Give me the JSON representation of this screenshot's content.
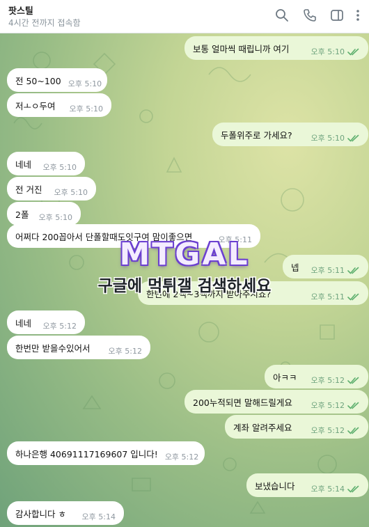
{
  "header": {
    "title": "팟스틸",
    "status": "4시간 전까지 접속함",
    "icons": [
      "search-icon",
      "phone-icon",
      "sidebar-toggle-icon",
      "more-vertical-icon"
    ]
  },
  "messages": [
    {
      "dir": "out",
      "text": "보통 얼마씩 때립니까 여기",
      "time": "오후 5:10"
    },
    {
      "dir": "in",
      "text": "전 50~100",
      "time": "오후 5:10"
    },
    {
      "dir": "in",
      "text": "저ㅗㅇ두여",
      "time": "오후 5:10"
    },
    {
      "dir": "out",
      "text": "두폴위주로 가세요?",
      "time": "오후 5:10"
    },
    {
      "dir": "in",
      "text": "네네",
      "time": "오후 5:10"
    },
    {
      "dir": "in",
      "text": "전 거진",
      "time": "오후 5:10"
    },
    {
      "dir": "in",
      "text": "2폴",
      "time": "오후 5:10"
    },
    {
      "dir": "in",
      "text": "어쩌다 200꼽아서 단폴할때도잇구여 맘이좋으면",
      "time": "오후 5:11"
    },
    {
      "dir": "out",
      "text": "넵",
      "time": "오후 5:11"
    },
    {
      "dir": "out",
      "text": "한번에 2백~3백까지 받아주시죠?",
      "time": "오후 5:11"
    },
    {
      "dir": "in",
      "text": "네네",
      "time": "오후 5:12"
    },
    {
      "dir": "in",
      "text": "한번만 받을수있어서",
      "time": "오후 5:12"
    },
    {
      "dir": "out",
      "text": "아ㅋㅋ",
      "time": "오후 5:12"
    },
    {
      "dir": "out",
      "text": "200누적되면 말해드릴게요",
      "time": "오후 5:12"
    },
    {
      "dir": "out",
      "text": "계좌 알려주세요",
      "time": "오후 5:12"
    },
    {
      "dir": "in",
      "text": "하나은행 40691117169607 입니다!",
      "time": "오후 5:12"
    },
    {
      "dir": "out",
      "text": "보냈습니다",
      "time": "오후 5:14"
    },
    {
      "dir": "in",
      "text": "감사합니다 ㅎ",
      "time": "오후 5:14"
    }
  ],
  "watermark": {
    "logo": "MTGAL",
    "text": "구글에 먹튀갤 검색하세요"
  },
  "colors": {
    "incoming_bubble": "#ffffff",
    "outgoing_bubble": "#eaf7d8",
    "read_check": "#5fb06f",
    "wallpaper": "#a9c48a"
  }
}
